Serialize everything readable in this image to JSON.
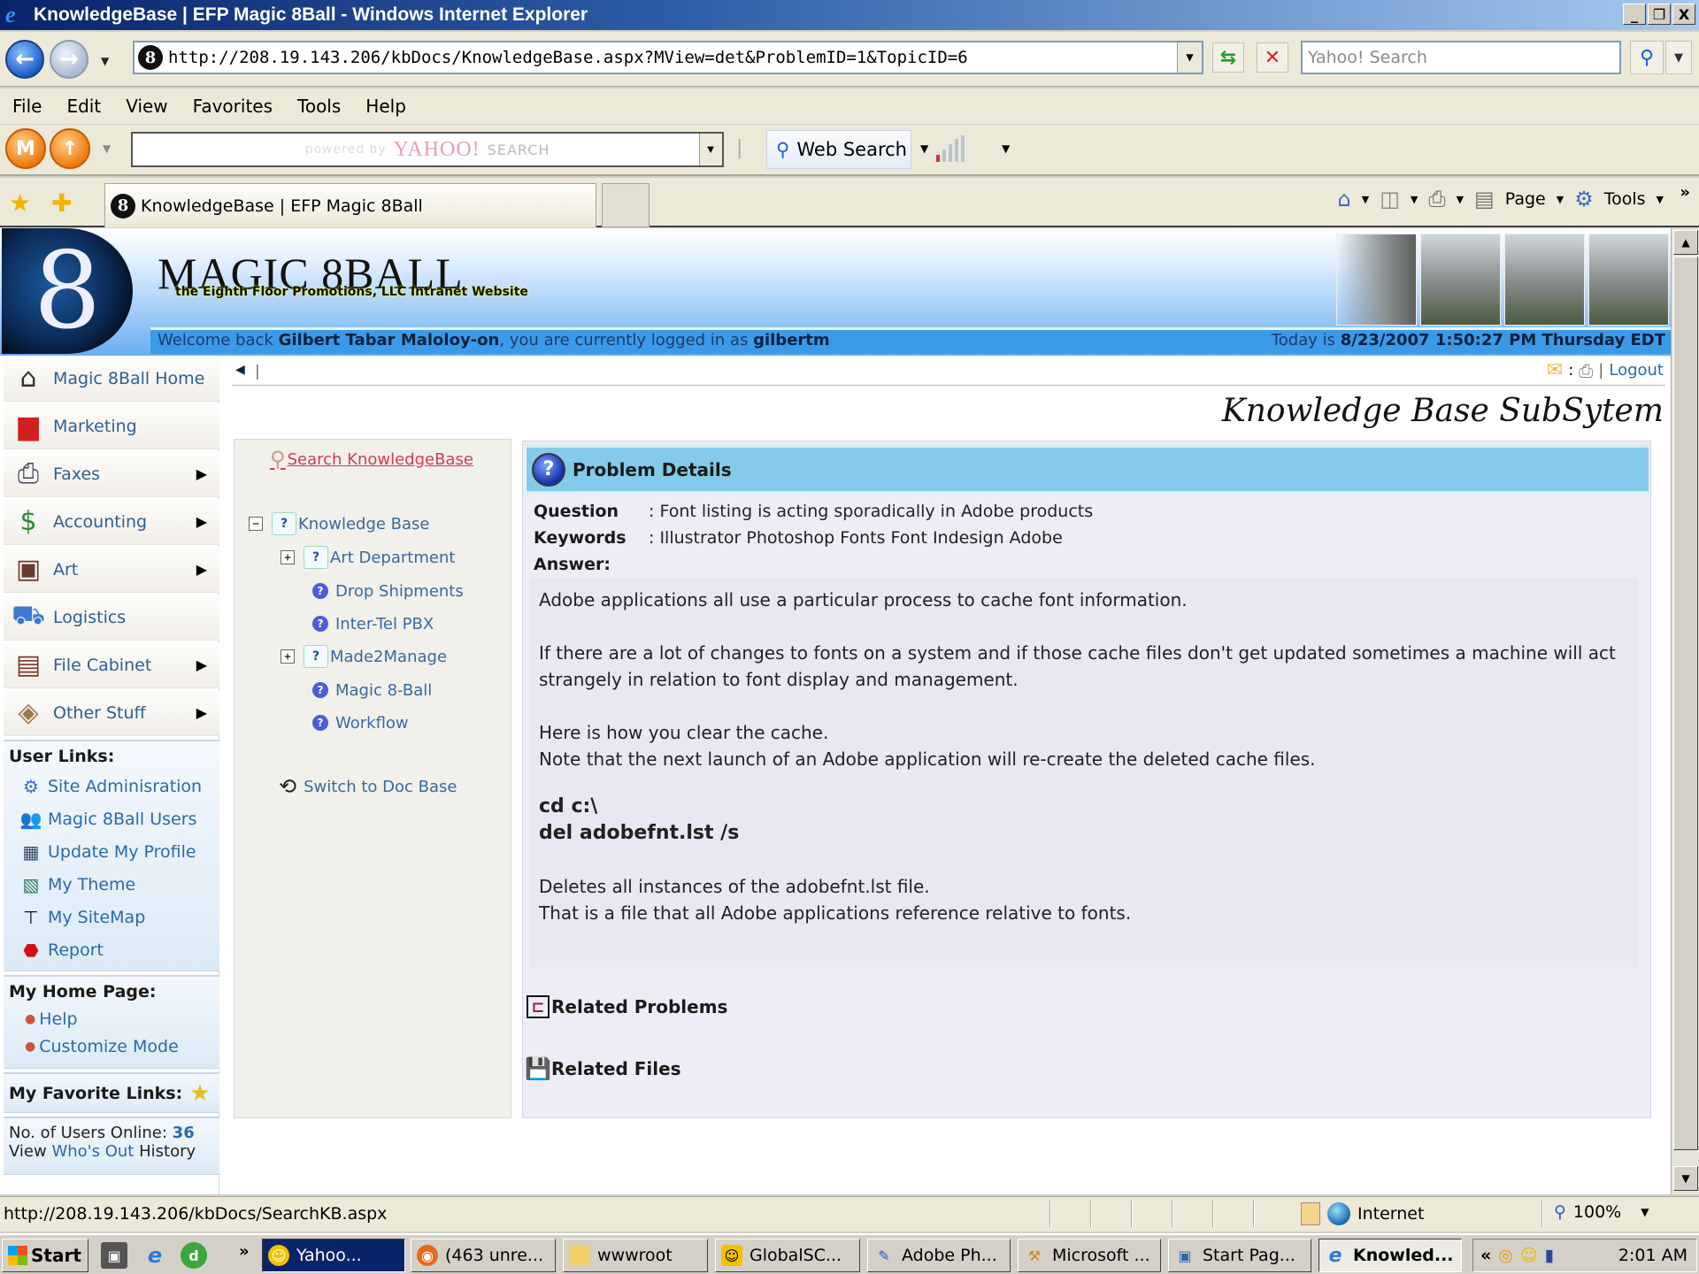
{
  "window": {
    "title": "KnowledgeBase | EFP Magic 8Ball - Windows Internet Explorer",
    "controls": [
      "_",
      "❐",
      "X"
    ]
  },
  "address_bar": {
    "url": "http://208.19.143.206/kbDocs/KnowledgeBase.aspx?MView=det&ProblemID=1&TopicID=6",
    "search_placeholder": "Yahoo! Search"
  },
  "menu": [
    "File",
    "Edit",
    "View",
    "Favorites",
    "Tools",
    "Help"
  ],
  "yahoo_toolbar": {
    "powered_by": "powered by",
    "brand": "YAHOO!",
    "search_word": "SEARCH",
    "web_search_label": "Web Search"
  },
  "tabs": [
    {
      "label": "KnowledgeBase | EFP Magic 8Ball",
      "active": true
    }
  ],
  "command_bar": {
    "page_label": "Page",
    "tools_label": "Tools"
  },
  "site": {
    "brand": "MAGIC 8BALL",
    "tagline": "the Eighth Floor Promotions, LLC Intranet Website",
    "welcome_prefix": "Welcome back",
    "user_full_name": "Gilbert Tabar Maloloy-on",
    "welcome_mid": ", you are currently logged in as",
    "username": "gilbertm",
    "today_prefix": "Today is",
    "today_value": "8/23/2007 1:50:27 PM Thursday EDT",
    "logout_label": "Logout",
    "subsystem_title": "Knowledge Base SubSytem"
  },
  "sidebar": {
    "nav": [
      {
        "label": "Magic 8Ball Home",
        "icon": "home-icon",
        "submenu": false
      },
      {
        "label": "Marketing",
        "icon": "bar-chart-icon",
        "submenu": false
      },
      {
        "label": "Faxes",
        "icon": "fax-icon",
        "submenu": true
      },
      {
        "label": "Accounting",
        "icon": "money-icon",
        "submenu": true
      },
      {
        "label": "Art",
        "icon": "picture-icon",
        "submenu": true
      },
      {
        "label": "Logistics",
        "icon": "truck-icon",
        "submenu": false
      },
      {
        "label": "File Cabinet",
        "icon": "file-cabinet-icon",
        "submenu": true
      },
      {
        "label": "Other Stuff",
        "icon": "box-icon",
        "submenu": true
      }
    ],
    "user_links": {
      "heading": "User Links:",
      "items": [
        {
          "label": "Site Adminisration",
          "icon": "admin-gear-icon"
        },
        {
          "label": "Magic 8Ball Users",
          "icon": "users-icon"
        },
        {
          "label": "Update My Profile",
          "icon": "profile-card-icon"
        },
        {
          "label": "My Theme",
          "icon": "theme-icon"
        },
        {
          "label": "My SiteMap",
          "icon": "sitemap-icon"
        },
        {
          "label": "Report",
          "icon": "alert-icon"
        }
      ]
    },
    "home_page": {
      "heading": "My Home Page:",
      "items": [
        "Help",
        "Customize Mode"
      ]
    },
    "favorites": {
      "heading": "My Favorite Links:"
    },
    "online": {
      "label": "No. of Users Online:",
      "count": "36",
      "view_prefix": "View",
      "view_link": "Who's Out",
      "view_suffix": "History"
    }
  },
  "tree": {
    "search_link": "Search KnowledgeBase",
    "nodes": [
      {
        "label": "Knowledge Base",
        "level": 0,
        "expander": "−",
        "type": "folder"
      },
      {
        "label": "Art Department",
        "level": 1,
        "expander": "+",
        "type": "folder"
      },
      {
        "label": "Drop Shipments",
        "level": 1,
        "expander": "",
        "type": "topic"
      },
      {
        "label": "Inter-Tel PBX",
        "level": 1,
        "expander": "",
        "type": "topic"
      },
      {
        "label": "Made2Manage",
        "level": 1,
        "expander": "+",
        "type": "folder"
      },
      {
        "label": "Magic 8-Ball",
        "level": 1,
        "expander": "",
        "type": "topic"
      },
      {
        "label": "Workflow",
        "level": 1,
        "expander": "",
        "type": "topic"
      }
    ],
    "switch_label": "Switch to Doc Base"
  },
  "details": {
    "heading": "Problem Details",
    "question_label": "Question",
    "question": ": Font listing is acting sporadically in Adobe products",
    "keywords_label": "Keywords",
    "keywords": ": Illustrator Photoshop Fonts Font Indesign Adobe",
    "answer_label": "Answer:",
    "answer": {
      "p1": "Adobe applications all use a particular process to cache font information.",
      "p2": "If there are a lot of changes to fonts on a system and if those cache files don't get updated sometimes a machine will act strangely in relation to font display and management.",
      "p3a": "Here is how you clear the cache.",
      "p3b": "Note that the next launch of an Adobe application will re-create the deleted cache files.",
      "code1": "cd c:\\",
      "code2": "del adobefnt.lst /s",
      "p4a": "Deletes all instances of the adobefnt.lst file.",
      "p4b": "That is a file that all Adobe applications reference relative to fonts."
    },
    "related_problems": "Related Problems",
    "related_files": "Related Files"
  },
  "status_bar": {
    "url": "http://208.19.143.206/kbDocs/SearchKB.aspx",
    "zone": "Internet",
    "zoom": "100%"
  },
  "taskbar": {
    "start": "Start",
    "items": [
      {
        "label": "Yahoo...",
        "state": "dark"
      },
      {
        "label": "(463 unre...",
        "state": "normal"
      },
      {
        "label": "wwwroot",
        "state": "normal"
      },
      {
        "label": "GlobalSC...",
        "state": "normal"
      },
      {
        "label": "Adobe Ph...",
        "state": "normal"
      },
      {
        "label": "Microsoft ...",
        "state": "normal"
      },
      {
        "label": "Start Pag...",
        "state": "normal"
      },
      {
        "label": "Knowled...",
        "state": "active"
      }
    ],
    "clock": "2:01 AM"
  }
}
